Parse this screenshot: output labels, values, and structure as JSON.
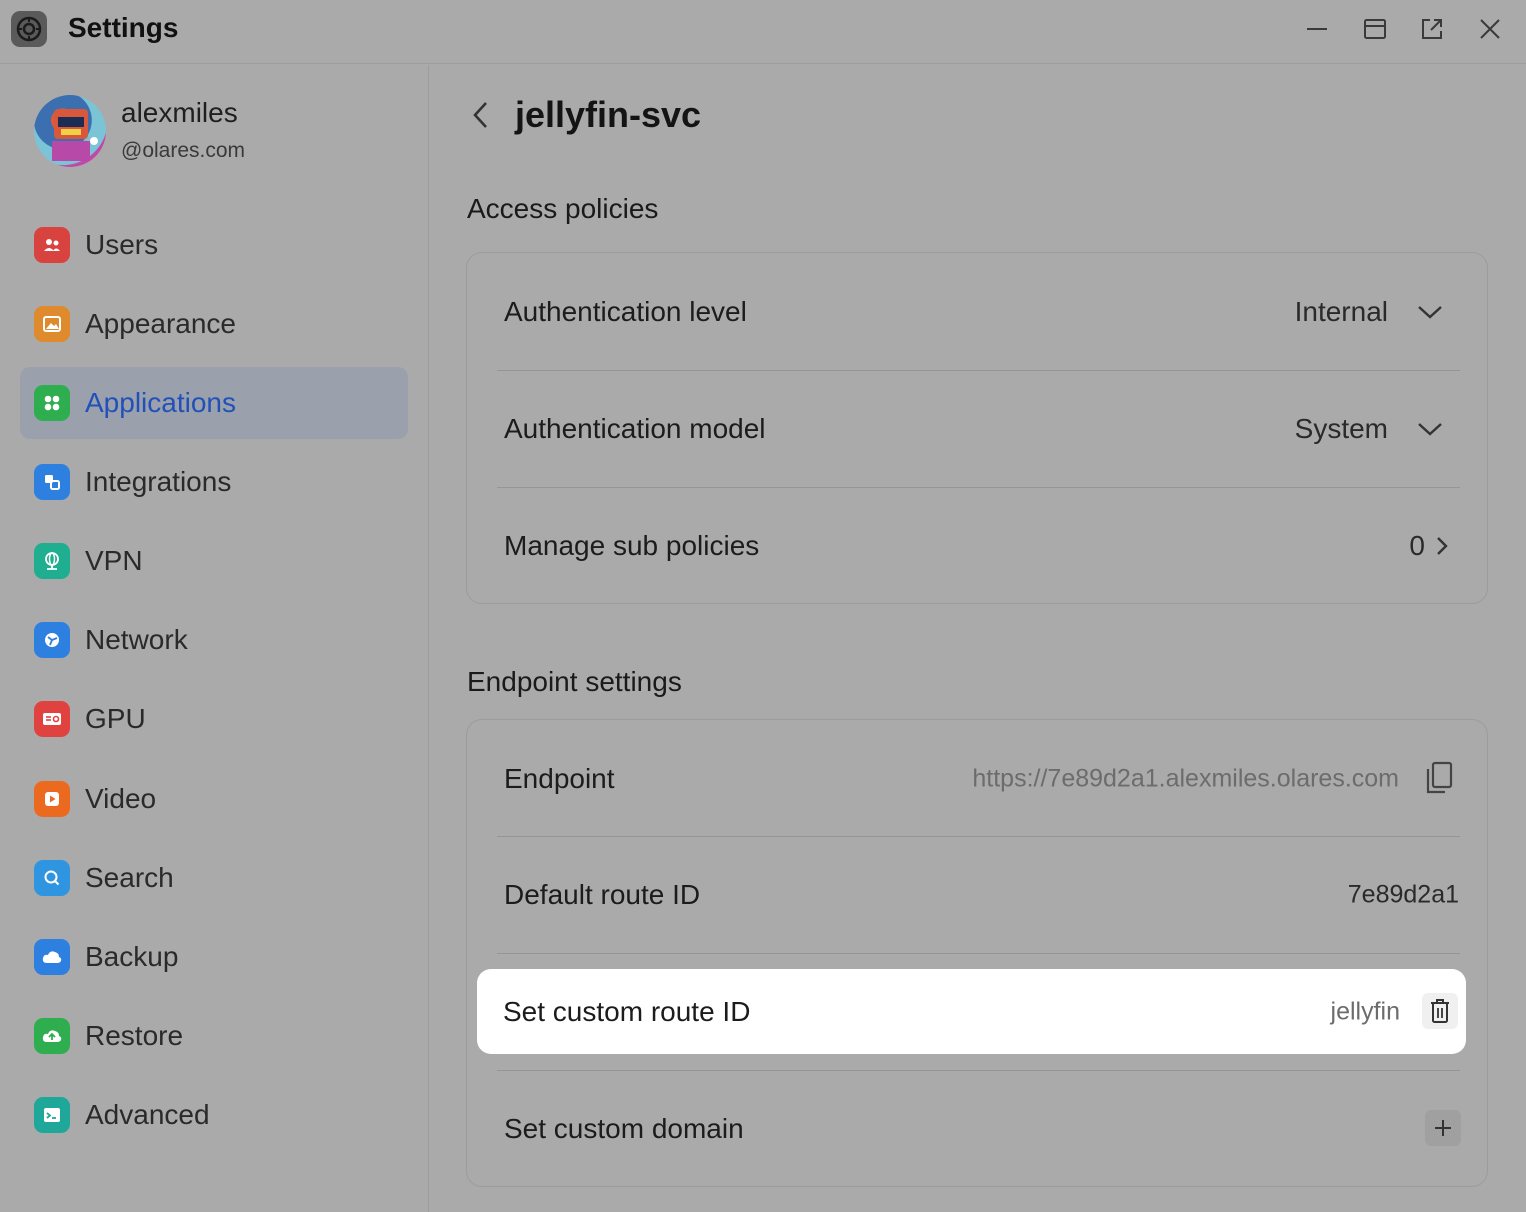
{
  "window": {
    "title": "Settings",
    "icons": [
      "settings-gear-icon",
      "minimize-icon",
      "maximize-icon",
      "open-external-icon",
      "close-icon"
    ]
  },
  "user": {
    "name": "alexmiles",
    "handle": "@olares.com"
  },
  "sidebar": {
    "items": [
      {
        "label": "Users",
        "icon": "users-icon",
        "color": "#e0433f"
      },
      {
        "label": "Appearance",
        "icon": "image-icon",
        "color": "#e58a2e"
      },
      {
        "label": "Applications",
        "icon": "apps-grid-icon",
        "color": "#2fae4f",
        "active": true
      },
      {
        "label": "Integrations",
        "icon": "integrations-icon",
        "color": "#2d7fe0"
      },
      {
        "label": "VPN",
        "icon": "globe-icon",
        "color": "#1fae8f"
      },
      {
        "label": "Network",
        "icon": "network-icon",
        "color": "#2d7fe0"
      },
      {
        "label": "GPU",
        "icon": "gpu-icon",
        "color": "#e0433f"
      },
      {
        "label": "Video",
        "icon": "video-icon",
        "color": "#ec6a1f"
      },
      {
        "label": "Search",
        "icon": "search-icon",
        "color": "#2f95e0"
      },
      {
        "label": "Backup",
        "icon": "cloud-icon",
        "color": "#2d7fe0"
      },
      {
        "label": "Restore",
        "icon": "cloud-restore-icon",
        "color": "#2fae4f"
      },
      {
        "label": "Advanced",
        "icon": "terminal-icon",
        "color": "#1fa89a"
      }
    ],
    "active_color": "#2151b8"
  },
  "main": {
    "title": "jellyfin-svc",
    "access": {
      "title": "Access policies",
      "auth_level_label": "Authentication level",
      "auth_level_value": "Internal",
      "auth_model_label": "Authentication model",
      "auth_model_value": "System",
      "sub_policies_label": "Manage sub policies",
      "sub_policies_value": "0"
    },
    "endpoint": {
      "title": "Endpoint settings",
      "endpoint_label": "Endpoint",
      "endpoint_value": "https://7e89d2a1.alexmiles.olares.com",
      "route_label": "Default route ID",
      "route_value": "7e89d2a1",
      "custom_route_label": "Set custom route ID",
      "custom_route_value": "jellyfin",
      "custom_domain_label": "Set custom domain"
    }
  }
}
